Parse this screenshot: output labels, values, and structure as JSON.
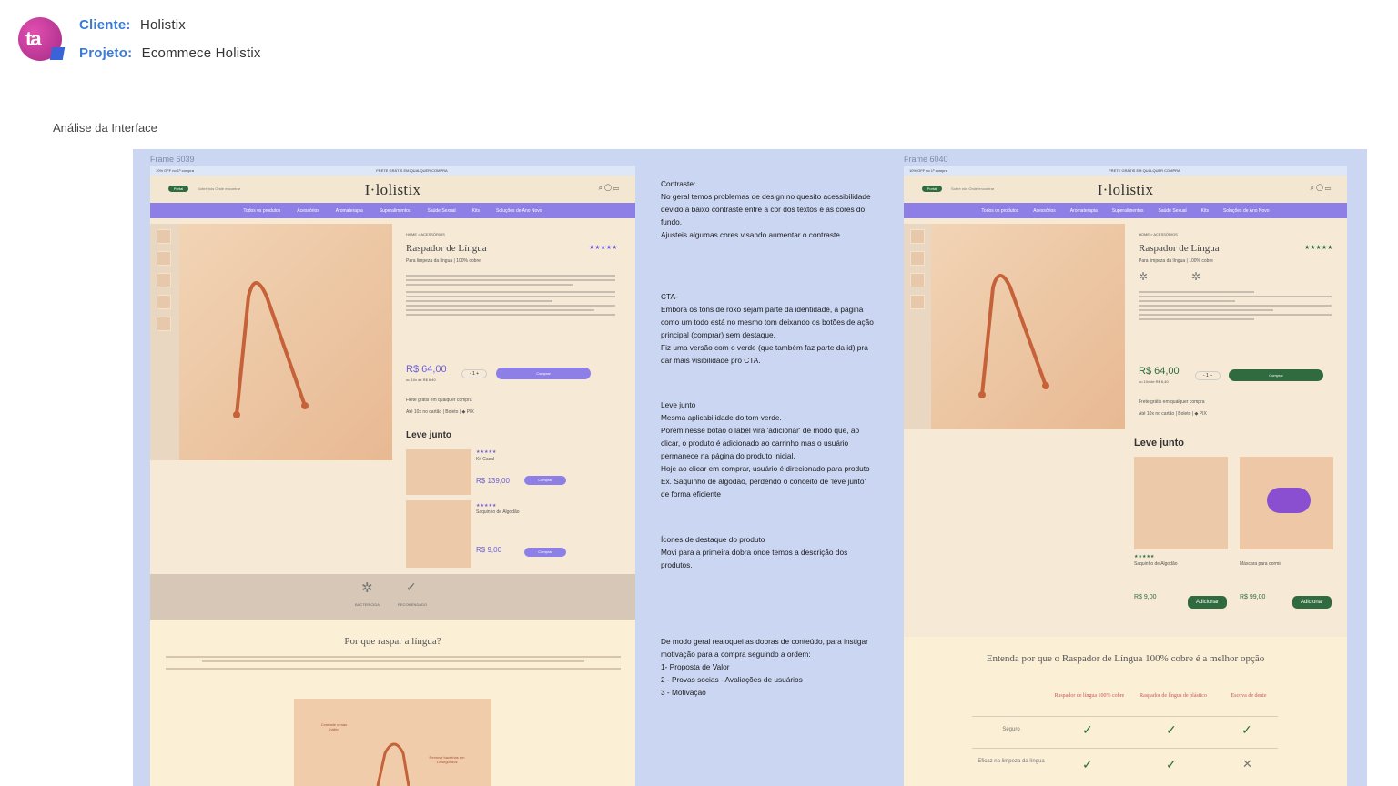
{
  "header": {
    "client_label": "Cliente:",
    "client_value": "Holistix",
    "project_label": "Projeto:",
    "project_value": "Ecommece Holistix",
    "section_title": "Análise da Interface"
  },
  "frames": {
    "left_label": "Frame 6039",
    "right_label": "Frame 6040"
  },
  "mock": {
    "promo_left": "10% OFF no 1º compra",
    "promo_center": "FRETE GRÁTIS EM QUALQUER COMPRA",
    "pill": "Portal",
    "toplinks": "Sobre nós     Onde encontrar",
    "brand": "I·lolistix",
    "nav": [
      "Todos os produtos",
      "Acessórios",
      "Aromaterapia",
      "Superalimentos",
      "Saúde Sexual",
      "Kits",
      "Soluções de Ano Novo"
    ],
    "breadcrumb": "HOME  >  ACESSÓRIOS",
    "product_title": "Raspador de Língua",
    "product_sub": "Para limpeza da língua | 100% cobre",
    "stars": "★★★★★",
    "price_left": "R$ 64,00",
    "price_right": "R$ 64,00",
    "installments": "ou 10x de R$ 6,40",
    "buy": "Comprar",
    "shipping": "Frete grátis em qualquer compra",
    "payments": "Até 10x no cartão  |  Boleto  |  ◆ PIX",
    "leve_junto_left": "Leve junto",
    "leve_junto_right": "Leve junto",
    "item1_name": "Kit Cacal",
    "item1_price": "R$ 139,00",
    "item2_name": "Saquinho de Algodão",
    "item2_price": "R$ 9,00",
    "right_item1_name": "Saquinho de Algodão",
    "right_item1_price": "R$ 9,00",
    "right_item2_name": "Máscara para dormir",
    "right_item2_price": "R$ 99,00",
    "add": "Adicionar",
    "icon_label1": "BACTERICIDA",
    "icon_label2": "RECOMENDADO",
    "why_left": "Por que raspar a língua?",
    "why_right": "Entenda por que o Raspador de Língua 100% cobre é a melhor opção",
    "callout1": "Combate o mau hálito",
    "callout2": "Remove bactérias em 10 segundos",
    "cmp_col1": "Raspador de língua 100% cobre",
    "cmp_col2": "Raspador de língua de plástico",
    "cmp_col3": "Escova de dente",
    "row1": "Seguro",
    "row2": "Eficaz na limpeza da língua"
  },
  "notes": [
    "Contraste:\nNo geral temos problemas de design no quesito acessibilidade devido a baixo contraste entre a cor dos textos e as cores do fundo.\nAjusteis algumas cores visando aumentar o contraste.",
    "CTA-\nEmbora os tons de roxo sejam parte da identidade, a página como um todo está no mesmo tom deixando os botões de ação principal (comprar) sem destaque.\nFiz uma versão com o verde (que também faz parte da id) pra dar mais visibilidade pro CTA.",
    "Leve junto\nMesma aplicabilidade do tom verde.\nPorém nesse botão o label vira 'adicionar' de modo que, ao clicar, o produto é adicionado ao carrinho mas o usuário permanece na página do produto inicial.\nHoje ao clicar em comprar, usuário é direcionado para produto Ex. Saquinho de algodão, perdendo o conceito de 'leve junto' de forma eficiente",
    "Ícones de destaque do produto\nMovi para a primeira dobra onde temos a descrição dos produtos.",
    "De modo geral realoquei as dobras de conteúdo, para instigar motivação para a compra seguindo a ordem:\n1- Proposta de Valor\n2 - Provas socias - Avaliações de usuários\n3 - Motivação"
  ],
  "colors": {
    "accent_blue": "#3a7bd5",
    "board": "#cbd6f2",
    "purple_cta": "#8e7fe6",
    "green_cta": "#2f6b3e"
  }
}
